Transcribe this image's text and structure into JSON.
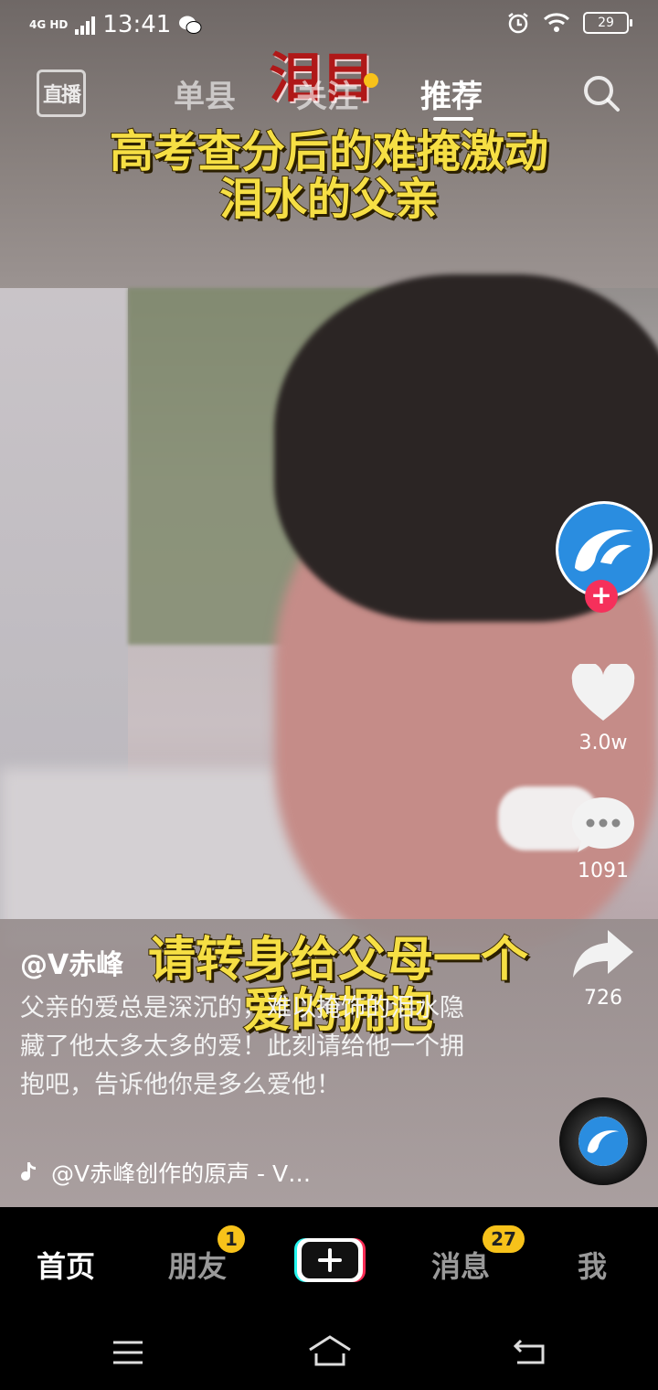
{
  "status": {
    "network": "4G HD",
    "time": "13:41",
    "battery": "29"
  },
  "topnav": {
    "tabs": [
      "直播",
      "单县",
      "关注",
      "推荐"
    ],
    "active_tab": "推荐",
    "search_icon": "search-icon"
  },
  "watermark_text": "泪目",
  "video": {
    "caption_top_line1": "高考查分后的难掩激动",
    "caption_top_line2": "泪水的父亲",
    "caption_bottom_line1": "请转身给父母一个",
    "caption_bottom_line2": "爱的拥抱",
    "author": "@V赤峰",
    "description": "父亲的爱总是深沉的，难以掩饰的泪水隐藏了他太多太多的爱！此刻请给他一个拥抱吧，告诉他你是多么爱他！",
    "sound": "@V赤峰创作的原声 - V…"
  },
  "actions": {
    "likes": "3.0w",
    "comments": "1091",
    "shares": "726"
  },
  "bottom_nav": {
    "home": "首页",
    "friends": "朋友",
    "friends_badge": "1",
    "messages": "消息",
    "messages_badge": "27",
    "me": "我"
  },
  "colors": {
    "accent_yellow": "#f7c21a",
    "follow_red": "#f5305b",
    "caption_yellow": "#f6df44"
  }
}
